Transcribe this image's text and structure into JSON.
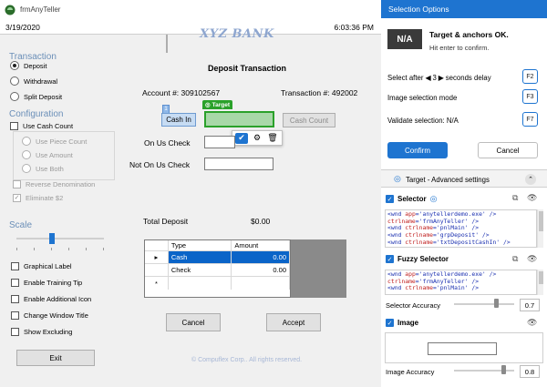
{
  "window": {
    "title": "frmAnyTeller",
    "date": "3/19/2020",
    "time": "6:03:36 PM"
  },
  "sidebar": {
    "transaction_title": "Transaction",
    "transaction_options": [
      {
        "label": "Deposit",
        "selected": true
      },
      {
        "label": "Withdrawal",
        "selected": false
      },
      {
        "label": "Split Deposit",
        "selected": false
      }
    ],
    "configuration_title": "Configuration",
    "use_cash_count": "Use Cash Count",
    "cash_count_options": [
      "Use Piece Count",
      "Use Amount",
      "Use Both"
    ],
    "reverse_denomination": "Reverse Denomination",
    "eliminate_2": "Eliminate $2",
    "scale_title": "Scale",
    "scale_level_fraction": 0.4,
    "checkboxes": [
      "Graphical Label",
      "Enable Training Tip",
      "Enable Additional Icon",
      "Change Window Title",
      "Show Excluding"
    ],
    "exit_label": "Exit"
  },
  "form": {
    "bank_name": "XYZ BANK",
    "heading": "Deposit Transaction",
    "account_label": "Account #: 309102567",
    "transaction_label": "Transaction #: 492002",
    "cash_in_label": "Cash In",
    "cash_count_label": "Cash Count",
    "on_us_check_label": "On Us Check",
    "not_on_us_check_label": "Not On Us Check",
    "total_deposit_label": "Total Deposit",
    "total_deposit_value": "$0.00",
    "grid": {
      "headers": [
        "Type",
        "Amount"
      ],
      "rows": [
        {
          "marker": "▸",
          "type": "Cash",
          "amount": "0.00",
          "selected": true
        },
        {
          "marker": "",
          "type": "Check",
          "amount": "0.00",
          "selected": false
        },
        {
          "marker": "*",
          "type": "",
          "amount": "",
          "selected": false
        }
      ]
    },
    "cancel_label": "Cancel",
    "accept_label": "Accept",
    "footer": "© Compuflex Corp.. All rights reserved.",
    "target_tag": "Target",
    "anchor_badge": "1"
  },
  "panel": {
    "header": "Selection Options",
    "status_badge": "N/A",
    "status_title": "Target & anchors OK.",
    "status_hint": "Hit enter to confirm.",
    "select_after_prefix": "Select after",
    "select_after_value": "3",
    "select_after_suffix": "seconds delay",
    "select_after_key": "F2",
    "image_selection_mode": "Image selection mode",
    "image_selection_key": "F3",
    "validate_selection": "Validate selection: N/A",
    "validate_key": "F7",
    "confirm_label": "Confirm",
    "cancel_label": "Cancel",
    "advanced_title": "Target - Advanced settings",
    "selector_title": "Selector",
    "selector_lines": [
      {
        "tag": "wnd",
        "attrs": [
          [
            "app",
            "'anytellerdemo.exe'"
          ]
        ]
      },
      {
        "tag": "",
        "attrs": [
          [
            "ctrlname",
            "'frmAnyTeller'"
          ]
        ]
      },
      {
        "tag": "wnd",
        "attrs": [
          [
            "ctrlname",
            "'pnlMain'"
          ]
        ]
      },
      {
        "tag": "wnd",
        "attrs": [
          [
            "ctrlname",
            "'grpDeposit'"
          ]
        ]
      },
      {
        "tag": "wnd",
        "attrs": [
          [
            "ctrlname",
            "'txtDepositCashIn'"
          ]
        ]
      }
    ],
    "fuzzy_title": "Fuzzy Selector",
    "fuzzy_lines": [
      {
        "tag": "wnd",
        "attrs": [
          [
            "app",
            "'anytellerdemo.exe'"
          ]
        ]
      },
      {
        "tag": "",
        "attrs": [
          [
            "ctrlname",
            "'frmAnyTeller'"
          ]
        ]
      },
      {
        "tag": "wnd",
        "attrs": [
          [
            "ctrlname",
            "'pnlMain'"
          ]
        ]
      }
    ],
    "selector_accuracy_label": "Selector Accuracy",
    "selector_accuracy_value": "0.7",
    "image_title": "Image",
    "image_accuracy_label": "Image Accuracy",
    "image_accuracy_value": "0.8",
    "accent": "#1e74d0",
    "target_green": "#2aa12a"
  }
}
